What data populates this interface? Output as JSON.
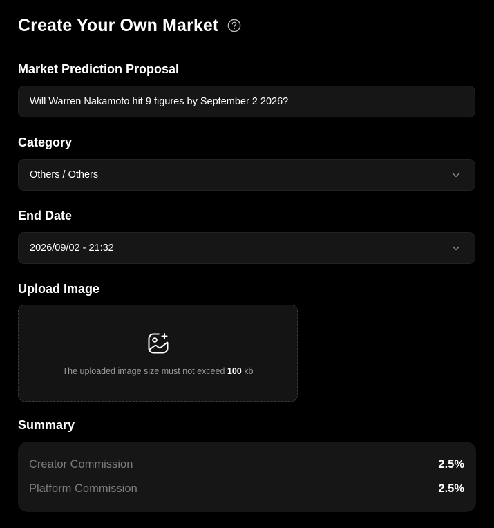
{
  "page": {
    "title": "Create Your Own Market"
  },
  "proposal": {
    "label": "Market Prediction Proposal",
    "value": "Will Warren Nakamoto hit 9 figures by September 2 2026?"
  },
  "category": {
    "label": "Category",
    "selected": "Others / Others"
  },
  "end_date": {
    "label": "End Date",
    "selected": "2026/09/02 - 21:32"
  },
  "upload": {
    "label": "Upload Image",
    "hint_prefix": "The uploaded image size must not exceed",
    "hint_value": "100",
    "hint_unit": "kb"
  },
  "summary": {
    "label": "Summary",
    "rows": [
      {
        "key": "Creator Commission",
        "value": "2.5%"
      },
      {
        "key": "Platform Commission",
        "value": "2.5%"
      }
    ]
  },
  "icons": {
    "help": "question-circle-icon",
    "chevron": "chevron-down-icon",
    "upload": "image-add-icon"
  },
  "colors": {
    "background": "#000000",
    "field_background": "#161616",
    "muted_text": "#7d7d7d"
  }
}
